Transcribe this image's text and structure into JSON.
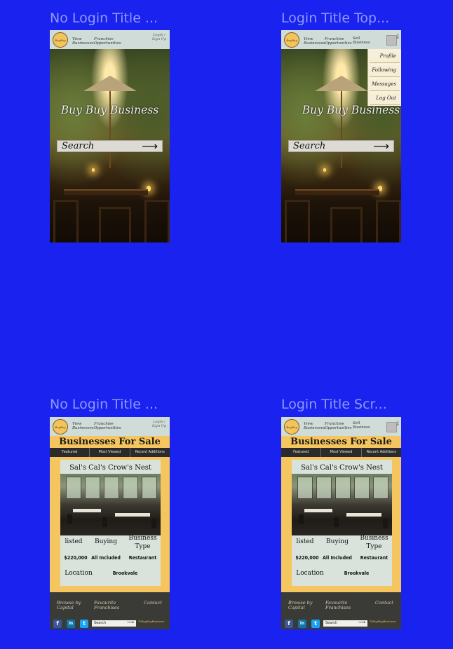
{
  "frames": [
    {
      "title": "No Login Title ...",
      "variant": "home",
      "logged_in": false
    },
    {
      "title": "Login Title Top...",
      "variant": "home",
      "logged_in": true
    },
    {
      "title": "No Login Title ...",
      "variant": "listing",
      "logged_in": false
    },
    {
      "title": "Login Title Scr...",
      "variant": "listing",
      "logged_in": true
    }
  ],
  "nav": {
    "logo": "BuyBuy",
    "view_businesses": "View Businesses",
    "franchise": "Franchise Opportunities",
    "sell_business": "Sell Business",
    "login": "Login / Sign Up",
    "menu_icon": "↓"
  },
  "home": {
    "hero_title": "Buy Buy Business",
    "search_label": "Search",
    "search_arrow": "⟶"
  },
  "dropdown": [
    "Profile",
    "Following",
    "Messages",
    "Log Out"
  ],
  "listing": {
    "title": "Businesses For Sale",
    "tabs": [
      "Featured",
      "Most Viewed",
      "Recent Additions"
    ],
    "card_title": "Sal's Cal's Crow's Nest",
    "row1": [
      "listed",
      "Buying",
      "Business Type"
    ],
    "row2": [
      "$220,000",
      "All Included",
      "Restaurant"
    ],
    "row3": [
      "Location",
      "Brookvale"
    ]
  },
  "footer": {
    "browse": "Browse by Capital",
    "favourite": "Favourite Franchises",
    "contact": "Contact",
    "search_placeholder": "Search",
    "copyright": "©BuyBuyBusiness",
    "social": [
      "f",
      "in",
      "t"
    ]
  },
  "colors": {
    "background": "#1a22f0",
    "nav_bg": "#cfdcd8",
    "listing_bg": "#f5c65f",
    "footer_bg": "#3a3a36"
  }
}
